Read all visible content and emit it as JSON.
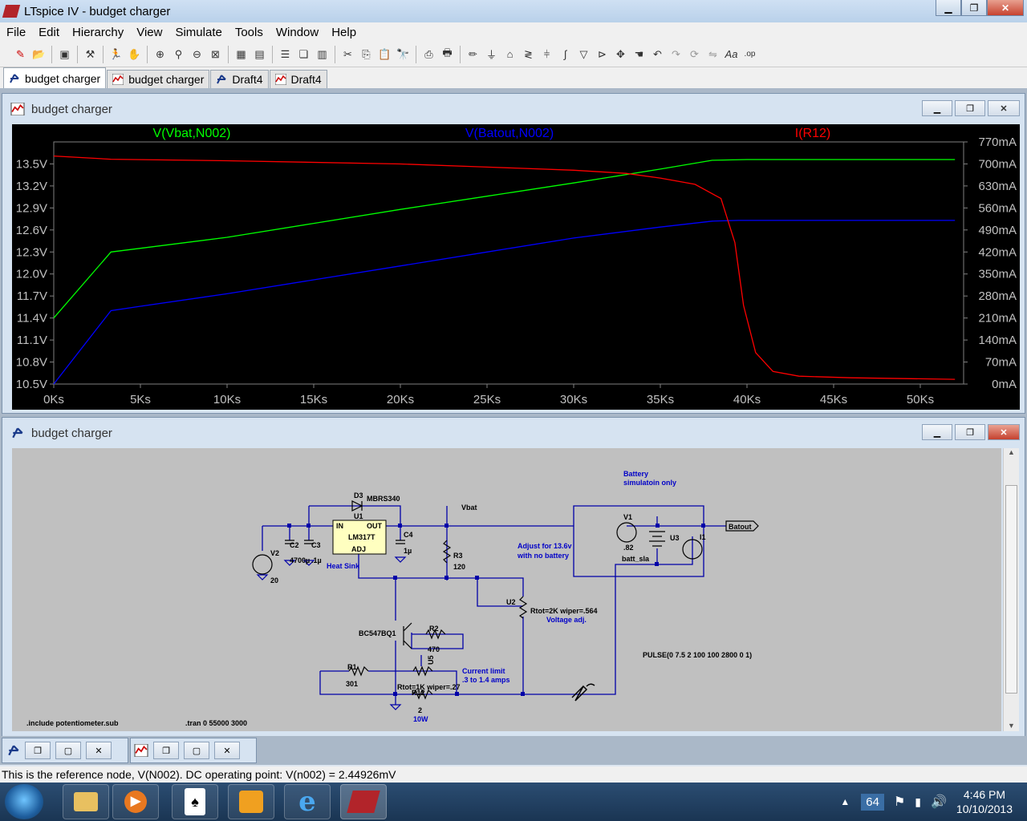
{
  "window": {
    "title": "LTspice IV - budget charger"
  },
  "menu": [
    "File",
    "Edit",
    "Hierarchy",
    "View",
    "Simulate",
    "Tools",
    "Window",
    "Help"
  ],
  "tabs": [
    {
      "label": "budget charger",
      "icon": "schematic-icon",
      "active": true
    },
    {
      "label": "budget charger",
      "icon": "waveform-icon",
      "active": false
    },
    {
      "label": "Draft4",
      "icon": "schematic-icon",
      "active": false
    },
    {
      "label": "Draft4",
      "icon": "waveform-icon",
      "active": false
    }
  ],
  "plot_window": {
    "title": "budget charger"
  },
  "schematic_window": {
    "title": "budget charger"
  },
  "chart_data": {
    "type": "line",
    "series": [
      {
        "name": "V(Vbat,N002)",
        "color": "#00ff00",
        "axis": "left",
        "x": [
          0,
          3300,
          5000,
          10000,
          15000,
          20000,
          25000,
          30000,
          35000,
          38000,
          40000,
          45000,
          52000
        ],
        "values": [
          11.4,
          12.3,
          12.35,
          12.5,
          12.69,
          12.88,
          13.06,
          13.24,
          13.43,
          13.55,
          13.56,
          13.56,
          13.56
        ]
      },
      {
        "name": "V(Batout,N002)",
        "color": "#0000ff",
        "axis": "left",
        "x": [
          0,
          3300,
          5000,
          10000,
          15000,
          20000,
          25000,
          30000,
          35000,
          38000,
          39500,
          45000,
          52000
        ],
        "values": [
          10.5,
          11.5,
          11.56,
          11.73,
          11.92,
          12.11,
          12.3,
          12.49,
          12.64,
          12.72,
          12.73,
          12.73,
          12.73
        ]
      },
      {
        "name": "I(R12)",
        "color": "#ff0000",
        "axis": "right",
        "x": [
          0,
          3300,
          10000,
          20000,
          25000,
          30000,
          33000,
          35000,
          37000,
          38500,
          39300,
          39800,
          40500,
          41500,
          43000,
          46000,
          52000
        ],
        "values": [
          0.725,
          0.715,
          0.71,
          0.7,
          0.69,
          0.68,
          0.67,
          0.655,
          0.635,
          0.59,
          0.45,
          0.25,
          0.1,
          0.04,
          0.025,
          0.02,
          0.015
        ]
      }
    ],
    "title": "",
    "xlabel": "",
    "ylabel": "",
    "xticks": [
      "0Ks",
      "5Ks",
      "10Ks",
      "15Ks",
      "20Ks",
      "25Ks",
      "30Ks",
      "35Ks",
      "40Ks",
      "45Ks",
      "50Ks"
    ],
    "xlim": [
      0,
      52500
    ],
    "yticks_left": [
      "10.5V",
      "10.8V",
      "11.1V",
      "11.4V",
      "11.7V",
      "12.0V",
      "12.3V",
      "12.6V",
      "12.9V",
      "13.2V",
      "13.5V"
    ],
    "ylim_left": [
      10.5,
      13.8
    ],
    "yticks_right": [
      "0mA",
      "70mA",
      "140mA",
      "210mA",
      "280mA",
      "350mA",
      "420mA",
      "490mA",
      "560mA",
      "630mA",
      "700mA",
      "770mA"
    ],
    "ylim_right": [
      0,
      0.77
    ],
    "grid": false,
    "legend": "top"
  },
  "schematic": {
    "labels": {
      "d3": "D3",
      "mbrs340": "MBRS340",
      "u1": "U1",
      "in": "IN",
      "out": "OUT",
      "lm317t": "LM317T",
      "adj": "ADJ",
      "heat_sink": "Heat Sink",
      "vbat": "Vbat",
      "c4": "C4",
      "c4v": "1µ",
      "r3": "R3",
      "r3v": "120",
      "v2": "V2",
      "v2v": "20",
      "c2": "C2",
      "c2v": "4700µ",
      "c3": "C3",
      "c3v": ".1µ",
      "battery_note1": "Battery",
      "battery_note2": "simulatoin only",
      "v1": "V1",
      "v1v": ".82",
      "u3": "U3",
      "i1": "I1",
      "batt_sla": "batt_sla",
      "batout": "Batout",
      "adjust1": "Adjust for 13.6v",
      "adjust2": "with no battery",
      "u2": "U2",
      "u2v": "Rtot=2K wiper=.564",
      "voltage_adj": "Voltage adj.",
      "q1": "BC547BQ1",
      "r2": "R2",
      "r2v": "470",
      "u5": "U5",
      "u5v": "Rtot=1K wiper=.27",
      "r1": "R1",
      "r1v": "301",
      "r12": "R12",
      "r12v": "2",
      "r12w": "10W",
      "current_limit1": "Current limit",
      "current_limit2": ".3 to 1.4 amps",
      "pulse": "PULSE(0 7.5 2 100 100 2800 0 1)",
      "include": ".include potentiometer.sub",
      "tran": ".tran 0 55000 3000"
    }
  },
  "status": "This is the reference node, V(N002).  DC operating point: V(n002) = 2.44926mV",
  "taskbar": {
    "apps": [
      "explorer-icon",
      "media-player-icon",
      "solitaire-icon",
      "outlook-icon",
      "internet-explorer-icon",
      "ltspice-icon"
    ],
    "tray_number": "64",
    "time": "4:46 PM",
    "date": "10/10/2013"
  }
}
